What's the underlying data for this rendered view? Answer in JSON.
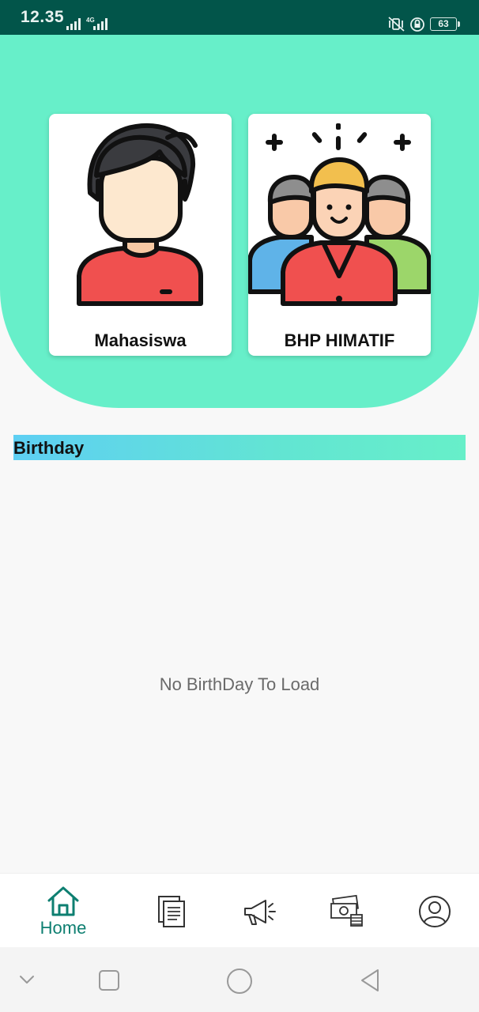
{
  "status_bar": {
    "time": "12.35",
    "network": "4G",
    "battery": "63"
  },
  "cards": [
    {
      "label": "Mahasiswa",
      "icon": "student-avatar-icon"
    },
    {
      "label": "BHP HIMATIF",
      "icon": "group-people-icon"
    }
  ],
  "birthday": {
    "title": "Birthday",
    "empty_message": "No BirthDay To Load"
  },
  "bottom_nav": {
    "items": [
      {
        "label": "Home",
        "icon": "home-icon",
        "active": true
      },
      {
        "label": "",
        "icon": "documents-icon",
        "active": false
      },
      {
        "label": "",
        "icon": "megaphone-icon",
        "active": false
      },
      {
        "label": "",
        "icon": "money-icon",
        "active": false
      },
      {
        "label": "",
        "icon": "profile-icon",
        "active": false
      }
    ]
  },
  "colors": {
    "status_bar": "#02554a",
    "accent": "#67efc9",
    "nav_active": "#0e7f71"
  }
}
